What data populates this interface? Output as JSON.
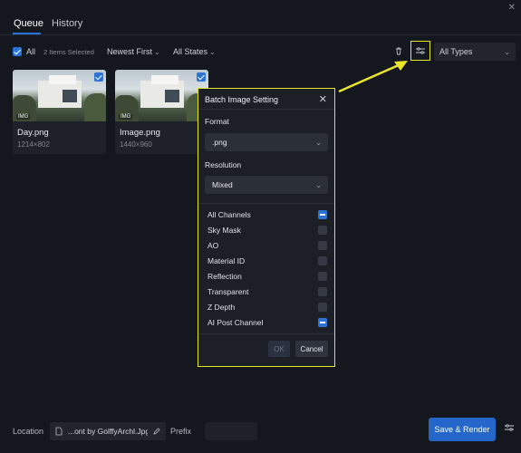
{
  "tabs": [
    {
      "label": "Queue"
    },
    {
      "label": "History"
    }
  ],
  "toolbar": {
    "all_label": "All",
    "selected_count": "2 Items Selected",
    "sort_label": "Newest First",
    "state_filter": "All States",
    "type_filter": "All Types"
  },
  "cards": [
    {
      "name": "Day.png",
      "dims": "1214×802",
      "badge": "IMG"
    },
    {
      "name": "Image.png",
      "dims": "1440×960",
      "badge": "IMG"
    }
  ],
  "dialog": {
    "title": "Batch Image Setting",
    "format_label": "Format",
    "format_value": ".png",
    "resolution_label": "Resolution",
    "resolution_value": "Mixed",
    "channels": [
      {
        "label": "All Channels",
        "state": "mixed"
      },
      {
        "label": "Sky Mask",
        "state": "unchecked"
      },
      {
        "label": "AO",
        "state": "unchecked"
      },
      {
        "label": "Material ID",
        "state": "unchecked"
      },
      {
        "label": "Reflection",
        "state": "unchecked"
      },
      {
        "label": "Transparent",
        "state": "unchecked"
      },
      {
        "label": "Z Depth",
        "state": "unchecked"
      },
      {
        "label": "AI Post Channel",
        "state": "mixed"
      }
    ],
    "ok_label": "OK",
    "cancel_label": "Cancel"
  },
  "footer": {
    "location_label": "Location",
    "location_value": "...ont by GolffyArchl.Jpg",
    "prefix_label": "Prefix",
    "render_label": "Save & Render"
  },
  "colors": {
    "accent": "#2b74d6",
    "highlight": "#e9e52a",
    "background": "#15171e"
  }
}
